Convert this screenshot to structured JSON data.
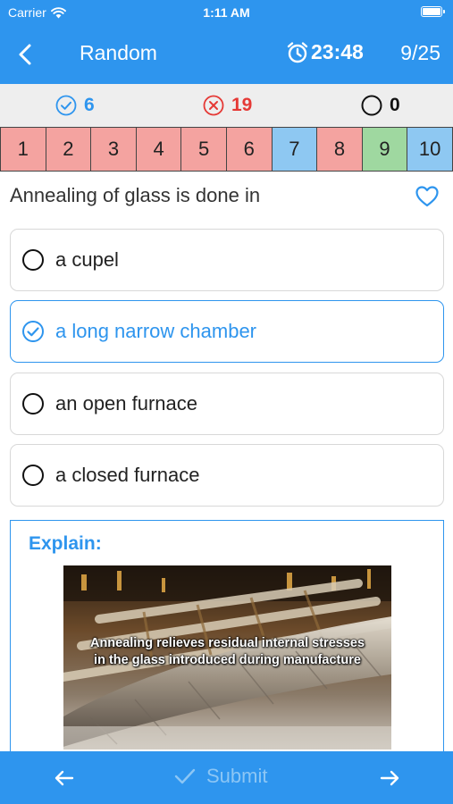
{
  "status_bar": {
    "carrier": "Carrier",
    "time": "1:11 AM"
  },
  "nav": {
    "title": "Random",
    "timer": "23:48",
    "progress": "9/25"
  },
  "scores": {
    "correct": "6",
    "wrong": "19",
    "unanswered": "0"
  },
  "question_nav": [
    {
      "label": "1",
      "state": "wrong"
    },
    {
      "label": "2",
      "state": "wrong"
    },
    {
      "label": "3",
      "state": "wrong"
    },
    {
      "label": "4",
      "state": "wrong"
    },
    {
      "label": "5",
      "state": "wrong"
    },
    {
      "label": "6",
      "state": "wrong"
    },
    {
      "label": "7",
      "state": "current"
    },
    {
      "label": "8",
      "state": "wrong"
    },
    {
      "label": "9",
      "state": "correct"
    },
    {
      "label": "10",
      "state": "current"
    }
  ],
  "question": {
    "text": "Annealing of glass is done in"
  },
  "options": [
    {
      "label": "a cupel",
      "selected": false
    },
    {
      "label": "a long narrow chamber",
      "selected": true
    },
    {
      "label": "an open furnace",
      "selected": false
    },
    {
      "label": "a closed furnace",
      "selected": false
    }
  ],
  "explain": {
    "title": "Explain:",
    "caption_line1": "Annealing relieves residual internal stresses",
    "caption_line2": "in the glass introduced during manufacture"
  },
  "bottom": {
    "submit_label": "Submit"
  },
  "colors": {
    "accent": "#2e95ee",
    "wrong": "#e53935",
    "wrong_cell": "#f4a3a0",
    "correct_cell": "#9fd8a0",
    "current_cell": "#8ec8f2"
  }
}
